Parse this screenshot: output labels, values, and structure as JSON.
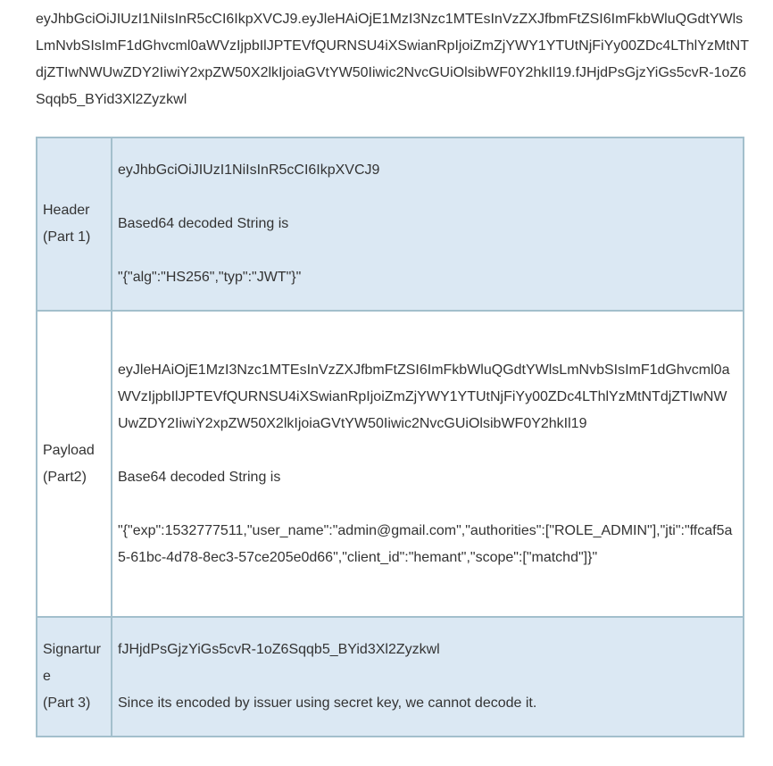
{
  "token": "eyJhbGciOiJIUzI1NiIsInR5cCI6IkpXVCJ9.eyJleHAiOjE1MzI3Nzc1MTEsInVzZXJfbmFtZSI6ImFkbWluQGdtYWlsLmNvbSIsImF1dGhvcml0aWVzIjpbIlJPTEVfQURNSU4iXSwianRpIjoiZmZjYWY1YTUtNjFiYy00ZDc4LThlYzMtNTdjZTIwNWUwZDY2IiwiY2xpZW50X2lkIjoiaGVtYW50Iiwic2NvcGUiOlsibWF0Y2hkIl19.fJHjdPsGjzYiGs5cvR-1oZ6Sqqb5_BYid3Xl2Zyzkwl",
  "rows": [
    {
      "label_line1": "Header",
      "label_line2": "(Part 1)",
      "encoded": "eyJhbGciOiJIUzI1NiIsInR5cCI6IkpXVCJ9",
      "note": "Based64 decoded String is",
      "decoded": "\"{\"alg\":\"HS256\",\"typ\":\"JWT\"}\""
    },
    {
      "label_line1": "Payload",
      "label_line2": "(Part2)",
      "encoded": "eyJleHAiOjE1MzI3Nzc1MTEsInVzZXJfbmFtZSI6ImFkbWluQGdtYWlsLmNvbSIsImF1dGhvcml0aWVzIjpbIlJPTEVfQURNSU4iXSwianRpIjoiZmZjYWY1YTUtNjFiYy00ZDc4LThlYzMtNTdjZTIwNWUwZDY2IiwiY2xpZW50X2lkIjoiaGVtYW50Iiwic2NvcGUiOlsibWF0Y2hkIl19",
      "note": "Base64 decoded String is",
      "decoded": "\"{\"exp\":1532777511,\"user_name\":\"admin@gmail.com\",\"authorities\":[\"ROLE_ADMIN\"],\"jti\":\"ffcaf5a5-61bc-4d78-8ec3-57ce205e0d66\",\"client_id\":\"hemant\",\"scope\":[\"matchd\"]}\""
    },
    {
      "label_line1": "Signarture",
      "label_line2": "(Part 3)",
      "encoded": "fJHjdPsGjzYiGs5cvR-1oZ6Sqqb5_BYid3Xl2Zyzkwl",
      "note": "Since its encoded by issuer using secret key, we cannot decode it."
    }
  ]
}
